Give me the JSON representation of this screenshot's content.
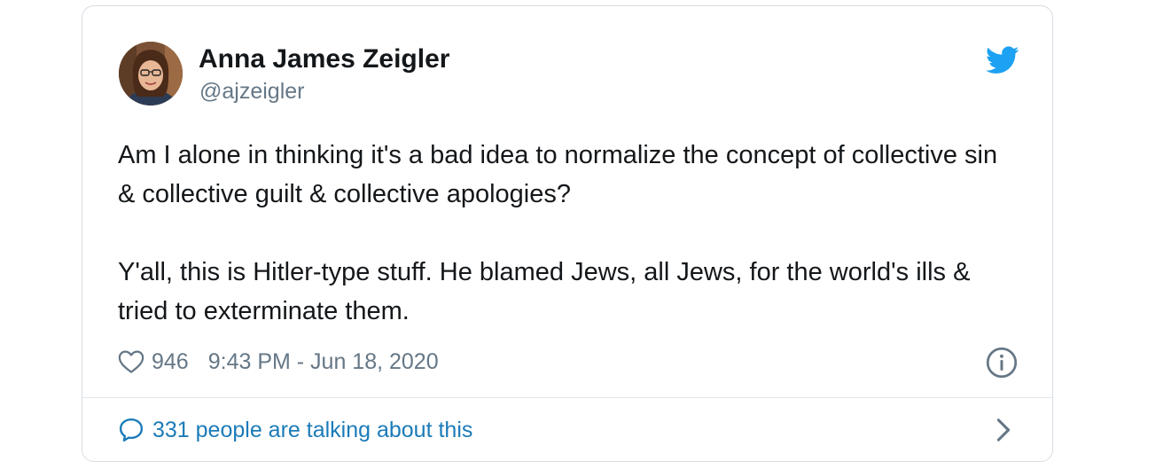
{
  "author": {
    "name": "Anna James Zeigler",
    "handle": "@ajzeigler",
    "avatar_icon": "profile-photo"
  },
  "tweet": {
    "paragraphs": [
      "Am I alone in thinking it's a bad idea to normalize the concept of collective sin & collective guilt & collective apologies?",
      "Y'all, this is Hitler-type stuff. He blamed Jews, all Jews, for the world's ills & tried to exterminate them."
    ]
  },
  "meta": {
    "likes": "946",
    "timestamp": "9:43 PM - Jun 18, 2020",
    "like_icon": "heart-icon",
    "info_icon": "info-icon"
  },
  "footer": {
    "discussion_text": "331 people are talking about this",
    "discussion_icon": "speech-bubble-icon",
    "chevron_icon": "chevron-right-icon"
  },
  "brand": {
    "logo_icon": "twitter-bird-icon",
    "accent_color": "#1DA1F2",
    "link_color": "#1B7BB8"
  }
}
